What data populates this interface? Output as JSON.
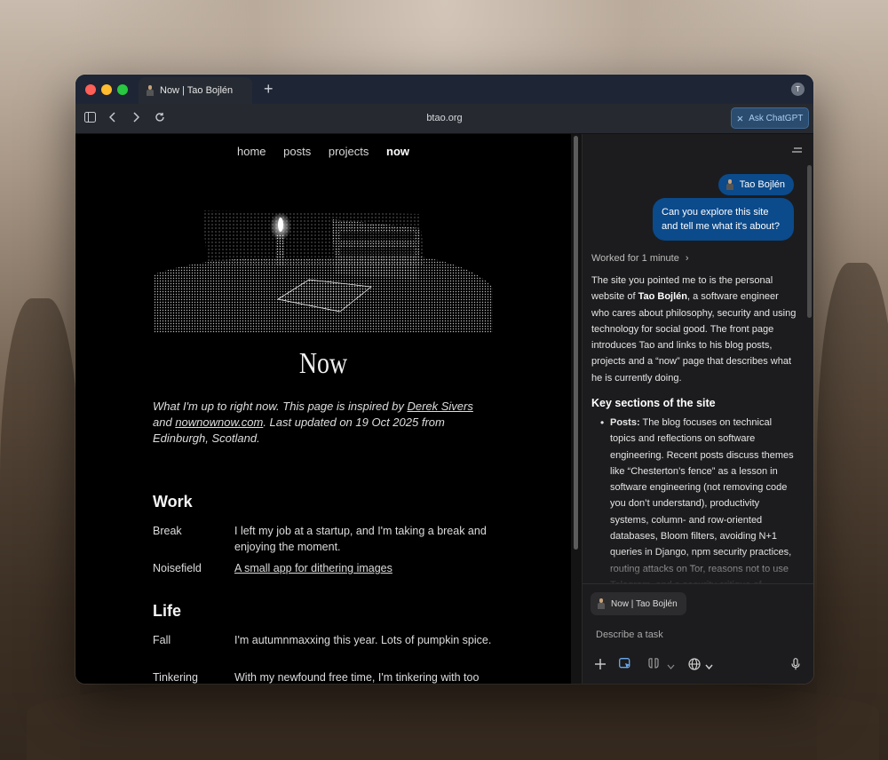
{
  "browser": {
    "tab_title": "Now | Tao Bojlén",
    "new_tab": "+",
    "profile_initial": "T",
    "url": "btao.org",
    "ask_label": "Ask ChatGPT",
    "ask_close": "×",
    "icons": [
      "sidebar-icon",
      "back-icon",
      "forward-icon",
      "reload-icon"
    ]
  },
  "page": {
    "nav": [
      "home",
      "posts",
      "projects",
      "now"
    ],
    "title": "Now",
    "intro": {
      "p1": "What I'm up to right now. This page is inspired by ",
      "link1": "Derek Sivers",
      "p2": " and ",
      "link2": "nownownow.com",
      "p3": ". Last updated on 19 Oct 2025 from Edinburgh, Scotland."
    },
    "sections": [
      {
        "heading": "Work",
        "rows": [
          {
            "key": "Break",
            "value": "I left my job at a startup, and I'm taking a break and enjoying the moment."
          },
          {
            "key": "Noisefield",
            "value": "A small app for dithering images"
          }
        ]
      },
      {
        "heading": "Life",
        "rows": [
          {
            "key": "Fall",
            "value": "I'm autumnmaxxing this year. Lots of pumpkin spice."
          },
          {
            "key": "Tinkering",
            "value": "With my newfound free time, I'm tinkering with too"
          }
        ]
      }
    ]
  },
  "chat": {
    "user_name": "Tao Bojlén",
    "user_message": "Can you explore this site and tell me what it's about?",
    "worked": "Worked for 1 minute",
    "worked_chevron": "›",
    "answer": {
      "p1": "The site you pointed me to is the personal website of ",
      "name": "Tao Bojlén",
      "p2": ", a software engineer who cares about philosophy, security and using technology for social good. The front page introduces Tao and links to his blog posts, projects and a “now” page that describes what he is currently doing."
    },
    "key_title": "Key sections of the site",
    "bullet_label": "Posts:",
    "bullet_text": " The blog focuses on technical topics and reflections on software engineering. Recent posts discuss themes like “Chesterton’s fence” as a lesson in software engineering (not removing code you don’t understand), productivity systems, column- and row-oriented databases, Bloom filters, avoiding N+1 queries in Django, npm security practices, routing attacks on Tor, reasons not to use Telegram, and a security critique of",
    "context_chip": "Now | Tao Bojlén",
    "task_placeholder": "Describe a task",
    "controls": [
      "plus-icon",
      "agent-mode-icon",
      "voice-mode-icon",
      "globe-icon",
      "microphone-icon"
    ]
  }
}
